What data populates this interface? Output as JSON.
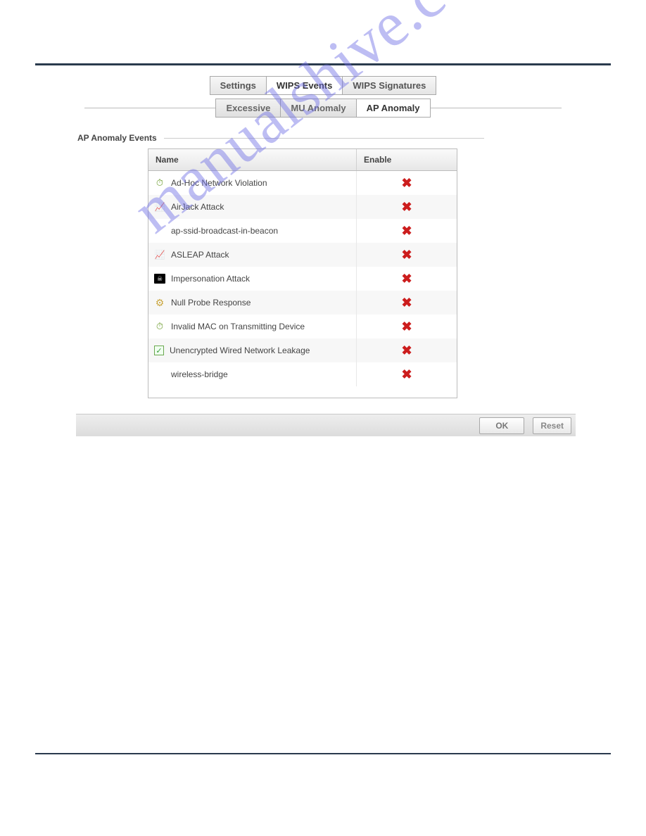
{
  "primary_tabs": {
    "settings": "Settings",
    "wips_events": "WIPS Events",
    "wips_signatures": "WIPS Signatures"
  },
  "secondary_tabs": {
    "excessive": "Excessive",
    "mu_anomaly": "MU Anomaly",
    "ap_anomaly": "AP Anomaly"
  },
  "section_title": "AP Anomaly Events",
  "columns": {
    "name": "Name",
    "enable": "Enable"
  },
  "rows": [
    {
      "icon": "gauge",
      "name": "Ad-Hoc Network Violation",
      "enabled": false
    },
    {
      "icon": "chart",
      "name": "AirJack Attack",
      "enabled": false
    },
    {
      "icon": "none",
      "name": "ap-ssid-broadcast-in-beacon",
      "enabled": false
    },
    {
      "icon": "chart",
      "name": "ASLEAP Attack",
      "enabled": false
    },
    {
      "icon": "skull",
      "name": "Impersonation Attack",
      "enabled": false
    },
    {
      "icon": "gear",
      "name": "Null Probe Response",
      "enabled": false
    },
    {
      "icon": "gauge",
      "name": "Invalid MAC on Transmitting Device",
      "enabled": false
    },
    {
      "icon": "check",
      "name": "Unencrypted Wired Network Leakage",
      "enabled": false
    },
    {
      "icon": "none",
      "name": "wireless-bridge",
      "enabled": false
    }
  ],
  "buttons": {
    "ok": "OK",
    "reset": "Reset"
  },
  "watermark": "manualshive.com"
}
